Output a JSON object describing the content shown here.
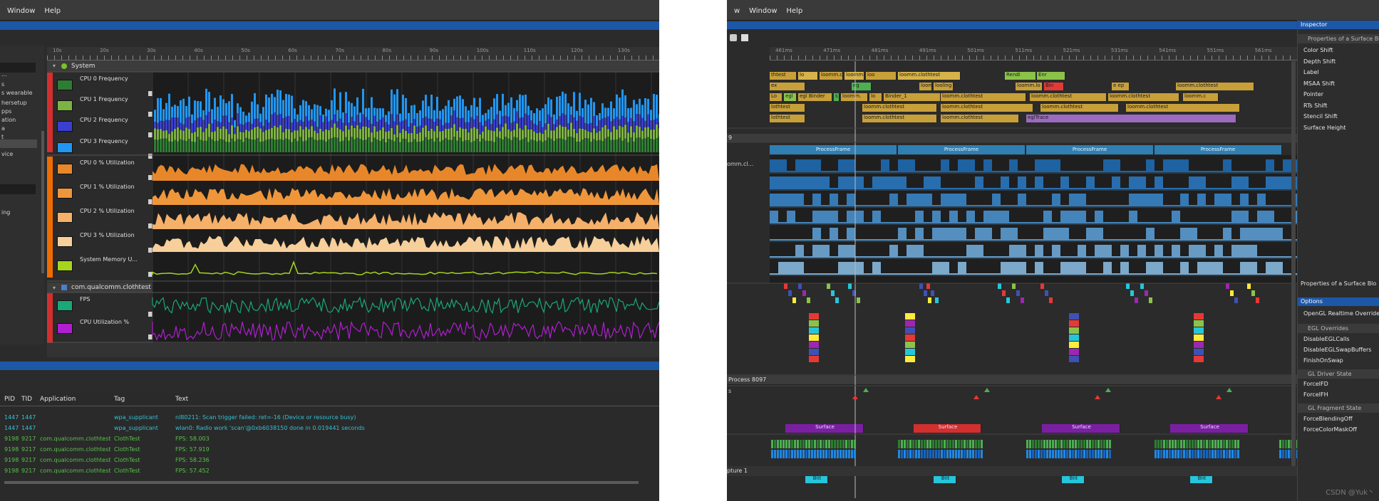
{
  "left_window": {
    "menu": [
      "Window",
      "Help"
    ],
    "ruler_labels": [
      "10s",
      "20s",
      "30s",
      "40s",
      "50s",
      "60s",
      "70s",
      "80s",
      "90s",
      "100s",
      "110s",
      "120s",
      "130s"
    ],
    "sidebar_items": [
      "...",
      "s",
      "s wearable",
      "hersetup",
      "pps",
      "ation",
      "a",
      "t",
      "s",
      "vice",
      "ing"
    ],
    "system_group": "System",
    "tracks": [
      {
        "label": "CPU 0 Frequency",
        "color": "#2e7d32",
        "scale": "10.0GHz"
      },
      {
        "label": "CPU 1 Frequency",
        "color": "#7cb342",
        "scale": ""
      },
      {
        "label": "CPU 2 Frequency",
        "color": "#3a3fcf",
        "scale": ""
      },
      {
        "label": "CPU 3 Frequency",
        "color": "#2196f3",
        "scale": ""
      },
      {
        "label": "CPU 0 % Utilization",
        "color": "#e8872a",
        "scale": "100%"
      },
      {
        "label": "CPU 1 % Utilization",
        "color": "#f0963a",
        "scale": "100%"
      },
      {
        "label": "CPU 2 % Utilization",
        "color": "#f5b06a",
        "scale": "100%"
      },
      {
        "label": "CPU 3 % Utilization",
        "color": "#f7cf9a",
        "scale": "100%"
      },
      {
        "label": "System Memory U...",
        "color": "#a5d61c",
        "scale": "100%"
      }
    ],
    "app_group": "com.qualcomm.clothtest",
    "app_tracks": [
      {
        "label": "FPS",
        "color": "#1aa77a"
      },
      {
        "label": "CPU Utilization %",
        "color": "#b11ed2"
      }
    ],
    "log": {
      "headers": [
        "PID",
        "TID",
        "Application",
        "Tag",
        "Text"
      ],
      "rows": [
        {
          "pid": "1447",
          "tid": "1447",
          "app": "",
          "tag": "wpa_supplicant",
          "text": "nl80211: Scan trigger failed: ret=-16 (Device or resource busy)",
          "color": "#33c1d6"
        },
        {
          "pid": "1447",
          "tid": "1447",
          "app": "",
          "tag": "wpa_supplicant",
          "text": "wlan0: Radio work 'scan'@0xb6038150 done in 0.019441 seconds",
          "color": "#33c1d6"
        },
        {
          "pid": "9198",
          "tid": "9217",
          "app": "com.qualcomm.clothtest",
          "tag": "ClothTest",
          "text": "FPS: 58.003",
          "color": "#58c24a"
        },
        {
          "pid": "9198",
          "tid": "9217",
          "app": "com.qualcomm.clothtest",
          "tag": "ClothTest",
          "text": "FPS: 57.919",
          "color": "#58c24a"
        },
        {
          "pid": "9198",
          "tid": "9217",
          "app": "com.qualcomm.clothtest",
          "tag": "ClothTest",
          "text": "FPS: 58.236",
          "color": "#58c24a"
        },
        {
          "pid": "9198",
          "tid": "9217",
          "app": "com.qualcomm.clothtest",
          "tag": "ClothTest",
          "text": "FPS: 57.452",
          "color": "#58c24a"
        }
      ]
    }
  },
  "right_window": {
    "menu": [
      "w",
      "Window",
      "Help"
    ],
    "process_label": "9",
    "thread_label": "omm.cl...",
    "process_row_label": "Process 8097",
    "s_label": "s",
    "capture_tab": "pture 1",
    "processframe_label": "ProcessFrame",
    "slices_row1": [
      "thtest",
      "lo",
      "loomm.clo",
      "loomm.cl",
      "loo",
      "loomm.clothtest",
      "Rendi",
      "Enr"
    ],
    "slices_row2": [
      "ex",
      "eg",
      "loomm.c",
      "looling",
      "loomm.lo",
      "Bin",
      "e ep",
      "loomm.clothtest"
    ],
    "slices_row3": [
      "Lo",
      "egl",
      "egl Binder",
      "s",
      "loomm.",
      "lo",
      "Binder_1",
      "loomm.clothtest",
      "loomm.clothtest",
      "loomm.clothtest",
      "loomm.c"
    ],
    "slices_row4": [
      "lothtest",
      "loomm.clothtest",
      "loomm.clothtest",
      "loomm.clothtest",
      "loomm.clothtest"
    ],
    "slices_row5": [
      "lothtest",
      "loomm.clothtest",
      "loomm.clothtest",
      "eglTrace"
    ],
    "bottom_slices": [
      "Surface",
      "Surface",
      "Surface",
      "Surface",
      "Surface"
    ],
    "blit": [
      "Blit",
      "Blit",
      "Blit",
      "Blit"
    ],
    "inspector": {
      "title": "Inspector",
      "section": "Properties of a Surface Bl",
      "props": [
        "Color Shift",
        "Depth Shift",
        "Label",
        "MSAA Shift",
        "Pointer",
        "RTs Shift",
        "Stencil Shift",
        "Surface Height"
      ],
      "props_caption": "Properties of a Surface Blo",
      "options_title": "Options",
      "override_label": "OpenGL Realtime Overrides",
      "egl_section": "EGL Overrides",
      "egl_items": [
        "DisableEGLCalls",
        "DisableEGLSwapBuffers",
        "FinishOnSwap"
      ],
      "gl_section": "GL Driver State",
      "gl_items": [
        "ForceIFD",
        "ForceIFH"
      ],
      "frag_section": "GL Fragment State",
      "frag_items": [
        "ForceBlendingOff",
        "ForceColorMaskOff"
      ]
    }
  },
  "watermark": "CSDN @Yuk丶"
}
